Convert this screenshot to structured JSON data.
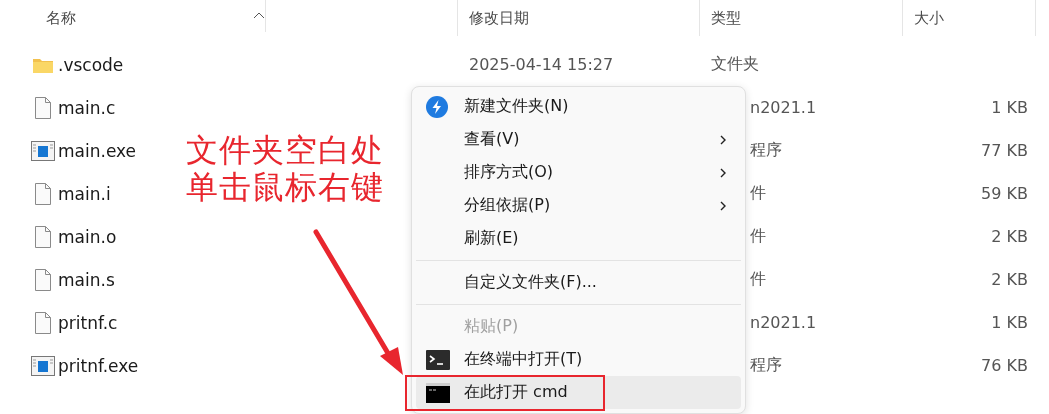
{
  "columns": [
    {
      "label": "名称"
    },
    {
      "label": "修改日期"
    },
    {
      "label": "类型"
    },
    {
      "label": "大小"
    }
  ],
  "files": [
    {
      "kind": "folder",
      "name": ".vscode",
      "date": "2025-04-14 15:27",
      "type": "文件夹",
      "partly_hidden": false
    },
    {
      "kind": "document",
      "name": "main.c",
      "type": "n2021.1",
      "size": "1 KB",
      "partly_hidden": true
    },
    {
      "kind": "program",
      "name": "main.exe",
      "type": "程序",
      "size": "77 KB",
      "partly_hidden": true
    },
    {
      "kind": "document",
      "name": "main.i",
      "type": "件",
      "size": "59 KB",
      "partly_hidden": true
    },
    {
      "kind": "document",
      "name": "main.o",
      "type": "件",
      "size": "2 KB",
      "partly_hidden": true
    },
    {
      "kind": "document",
      "name": "main.s",
      "type": "件",
      "size": "2 KB",
      "partly_hidden": true
    },
    {
      "kind": "document",
      "name": "pritnf.c",
      "type": "n2021.1",
      "size": "1 KB",
      "partly_hidden": true
    },
    {
      "kind": "program",
      "name": "pritnf.exe",
      "type": "程序",
      "size": "76 KB",
      "partly_hidden": true
    }
  ],
  "context_menu": {
    "items": [
      {
        "kind": "shortcut",
        "label": "新建文件夹(N)",
        "submenu": false,
        "disabled": false,
        "selected": false
      },
      {
        "kind": "item",
        "label": "查看(V)",
        "submenu": true,
        "disabled": false,
        "selected": false
      },
      {
        "kind": "item",
        "label": "排序方式(O)",
        "submenu": true,
        "disabled": false,
        "selected": false
      },
      {
        "kind": "item",
        "label": "分组依据(P)",
        "submenu": true,
        "disabled": false,
        "selected": false
      },
      {
        "kind": "item",
        "label": "刷新(E)",
        "submenu": false,
        "disabled": false,
        "selected": false
      },
      {
        "kind": "separator"
      },
      {
        "kind": "item",
        "label": "自定义文件夹(F)...",
        "submenu": false,
        "disabled": false,
        "selected": false
      },
      {
        "kind": "separator"
      },
      {
        "kind": "item",
        "label": "粘贴(P)",
        "submenu": false,
        "disabled": true,
        "selected": false
      },
      {
        "kind": "terminal",
        "label": "在终端中打开(T)",
        "submenu": false,
        "disabled": false,
        "selected": false
      },
      {
        "kind": "console",
        "label": "在此打开 cmd",
        "submenu": false,
        "disabled": false,
        "selected": true
      }
    ]
  },
  "annotation": {
    "lines": [
      "文件夹空白处",
      "单击鼠标右键"
    ]
  }
}
